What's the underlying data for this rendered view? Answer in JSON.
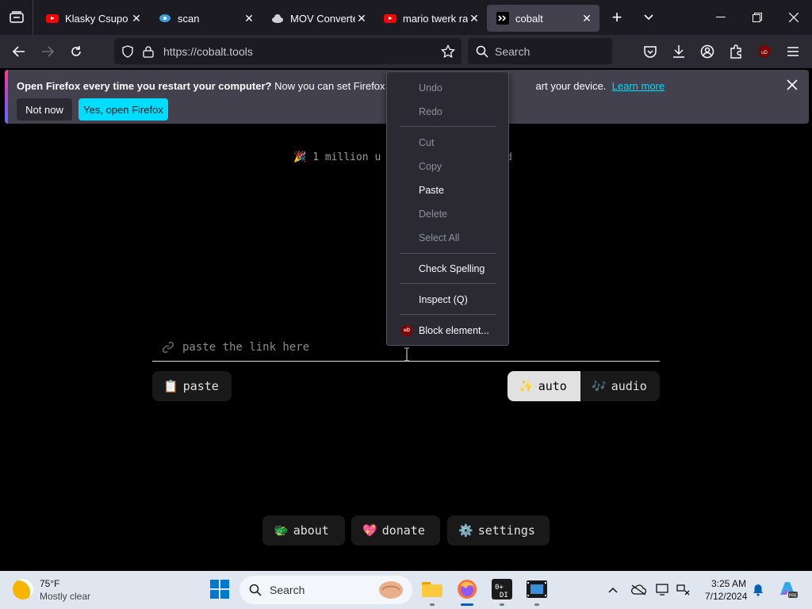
{
  "tabs": [
    {
      "title": "Klasky Csupo No",
      "favicon": "youtube-icon",
      "active": false
    },
    {
      "title": "scan",
      "favicon": "scan-icon",
      "active": false
    },
    {
      "title": "MOV Converter",
      "favicon": "cloud-icon",
      "active": false
    },
    {
      "title": "mario twerk race",
      "favicon": "youtube-icon",
      "active": false
    },
    {
      "title": "cobalt",
      "favicon": "cobalt-icon",
      "active": true
    }
  ],
  "navbar": {
    "url": "https://cobalt.tools",
    "search_placeholder": "Search"
  },
  "notification": {
    "bold": "Open Firefox every time you restart your computer?",
    "text": " Now you can set Firefox to open",
    "text_tail": "art your device.",
    "learn_more": "Learn more",
    "not_now": "Not now",
    "yes": "Yes, open Firefox"
  },
  "page": {
    "banner_emoji": "🎉",
    "banner_left": "1 million u",
    "banner_right": "ed",
    "input_placeholder": "paste the link here",
    "paste_emoji": "📋",
    "paste_label": "paste",
    "auto_emoji": "✨",
    "auto_label": "auto",
    "audio_emoji": "🎶",
    "audio_label": "audio",
    "about_emoji": "🐲",
    "about_label": "about",
    "donate_emoji": "💖",
    "donate_label": "donate",
    "settings_emoji": "⚙️",
    "settings_label": "settings"
  },
  "context_menu": {
    "undo": "Undo",
    "redo": "Redo",
    "cut": "Cut",
    "copy": "Copy",
    "paste": "Paste",
    "delete": "Delete",
    "select_all": "Select All",
    "check_spelling": "Check Spelling",
    "inspect": "Inspect (Q)",
    "block_element": "Block element...",
    "ubo_badge": "uD"
  },
  "taskbar": {
    "temperature": "75°F",
    "condition": "Mostly clear",
    "search": "Search",
    "time": "3:25 AM",
    "date": "7/12/2024"
  },
  "colors": {
    "accent": "#00ddff",
    "tab_active": "#42414d",
    "toolbar": "#2b2a33"
  }
}
